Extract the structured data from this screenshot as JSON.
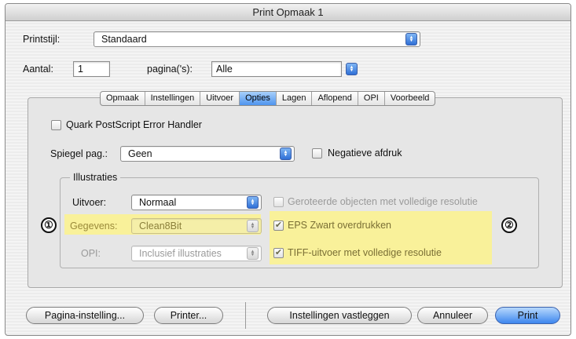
{
  "window": {
    "title": "Print Opmaak 1"
  },
  "style": {
    "label": "Printstijl:",
    "value": "Standaard"
  },
  "copies": {
    "label": "Aantal:",
    "value": "1",
    "pages_label": "pagina('s):",
    "pages_value": "Alle"
  },
  "tabs": [
    {
      "label": "Opmaak",
      "active": false
    },
    {
      "label": "Instellingen",
      "active": false
    },
    {
      "label": "Uitvoer",
      "active": false
    },
    {
      "label": "Opties",
      "active": true
    },
    {
      "label": "Lagen",
      "active": false
    },
    {
      "label": "Aflopend",
      "active": false
    },
    {
      "label": "OPI",
      "active": false
    },
    {
      "label": "Voorbeeld",
      "active": false
    }
  ],
  "options": {
    "quark_handler": {
      "label": "Quark PostScript Error Handler",
      "checked": false
    },
    "mirror": {
      "label": "Spiegel pag.:",
      "value": "Geen"
    },
    "negative": {
      "label": "Negatieve afdruk",
      "checked": false
    }
  },
  "illustrations": {
    "title": "Illustraties",
    "output": {
      "label": "Uitvoer:",
      "value": "Normaal"
    },
    "data": {
      "label": "Gegevens:",
      "value": "Clean8Bit"
    },
    "opi": {
      "label": "OPI:",
      "value": "Inclusief illustraties"
    },
    "rotated": {
      "label": "Geroteerde objecten met  volledige resolutie",
      "checked": false
    },
    "eps_black": {
      "label": "EPS Zwart overdrukken",
      "checked": true
    },
    "tiff_full": {
      "label": "TIFF-uitvoer met volledige resolutie",
      "checked": true
    }
  },
  "callouts": {
    "one": "①",
    "two": "②"
  },
  "buttons": {
    "page_setup": "Pagina-instelling...",
    "printer": "Printer...",
    "save_settings": "Instellingen vastleggen",
    "cancel": "Annuleer",
    "print": "Print"
  },
  "colors": {
    "highlight": "#fbf28c",
    "accent": "#3d86ee"
  }
}
